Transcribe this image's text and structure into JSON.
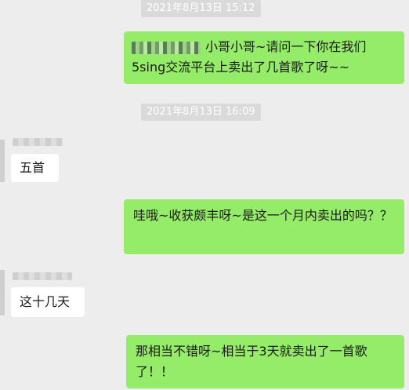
{
  "chat": {
    "timestamps": [
      "2021年8月13日 15:12",
      "2021年8月13日 16:09"
    ],
    "messages": [
      {
        "text": "小哥小哥~请问一下你在我们5sing交流平台上卖出了几首歌了呀~~"
      },
      {
        "text": "五首"
      },
      {
        "text": "哇哦~收获颇丰呀~是这一个月内卖出的吗？？"
      },
      {
        "text": "这十几天"
      },
      {
        "text": "那相当不错呀~相当于3天就卖出了一首歌了！！"
      }
    ]
  },
  "colors": {
    "background": "#ededed",
    "outgoing_bubble": "#95ec69",
    "incoming_bubble": "#ffffff",
    "timestamp_pill": "#dadada"
  }
}
